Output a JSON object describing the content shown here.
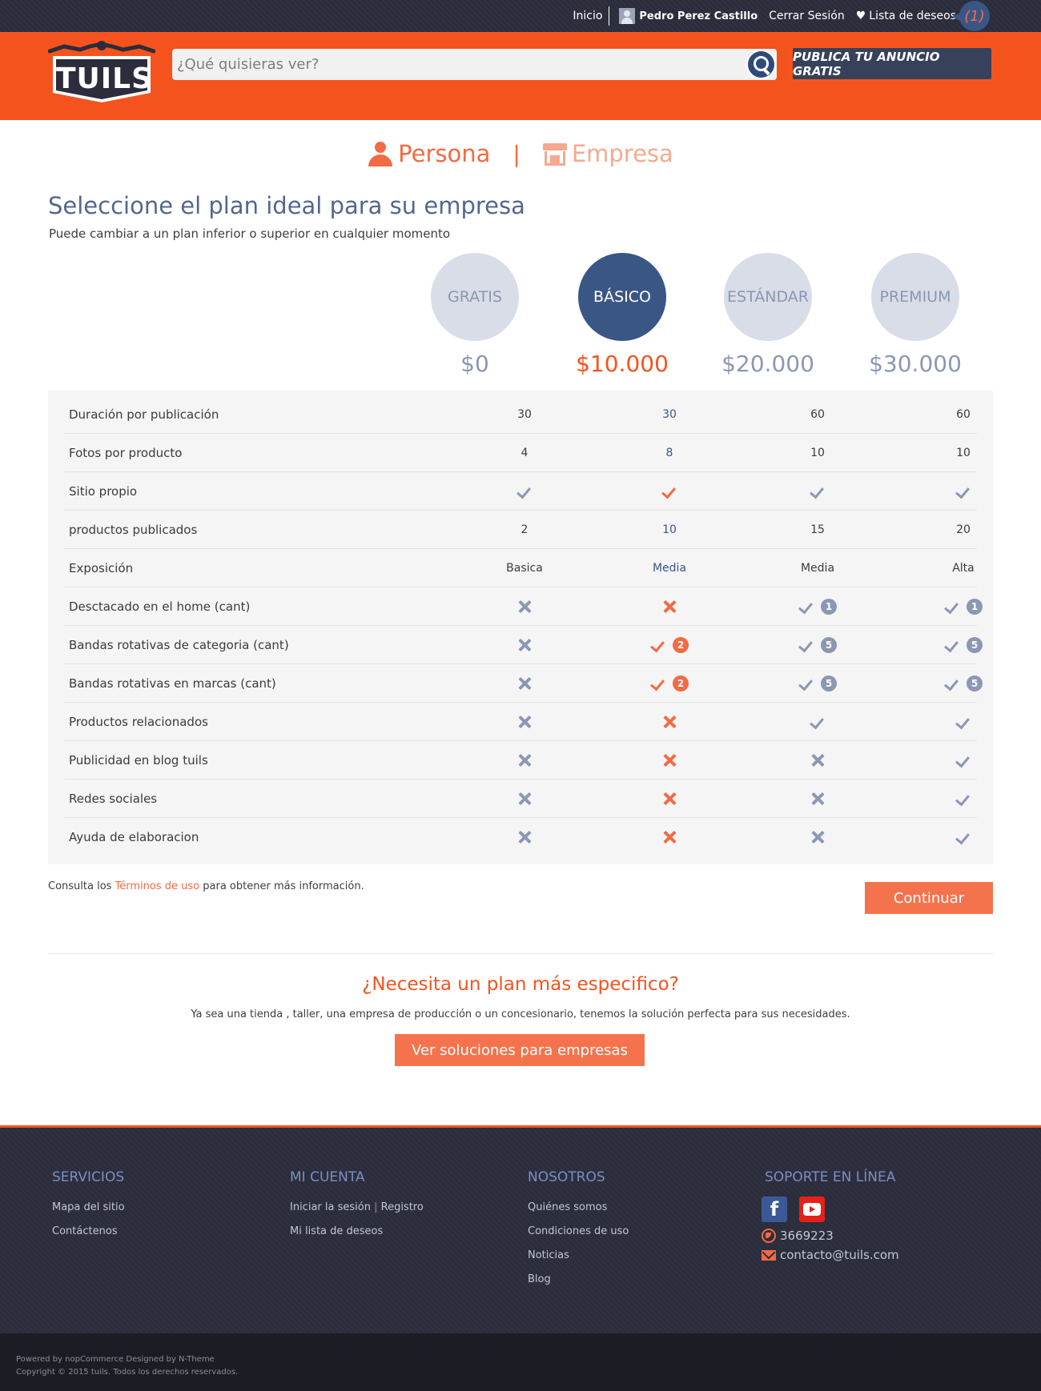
{
  "topbar": {
    "home": "Inicio",
    "user": "Pedro Perez Castillo",
    "logout": "Cerrar Sesión",
    "wishlist": "Lista de deseos",
    "wishlist_count": "(1)"
  },
  "header": {
    "logo_text": "TUILS",
    "search_placeholder": "¿Qué quisieras ver?",
    "publish_button": "PUBLICA TU ANUNCIO GRATIS"
  },
  "type_tabs": {
    "persona": "Persona",
    "separator": "|",
    "empresa": "Empresa"
  },
  "page": {
    "title": "Seleccione el plan ideal para su empresa",
    "subtitle": "Puede cambiar a un plan inferior o superior en cualquier momento"
  },
  "plans": [
    {
      "name": "GRATIS",
      "price": "$0",
      "active": false
    },
    {
      "name": "BÁSICO",
      "price": "$10.000",
      "active": true
    },
    {
      "name": "ESTÁNDAR",
      "price": "$20.000",
      "active": false
    },
    {
      "name": "PREMIUM",
      "price": "$30.000",
      "active": false
    }
  ],
  "features": [
    {
      "label": "Duración por publicación",
      "cells": [
        {
          "text": "30"
        },
        {
          "text": "30"
        },
        {
          "text": "60"
        },
        {
          "text": "60"
        }
      ]
    },
    {
      "label": "Fotos por producto",
      "cells": [
        {
          "text": "4"
        },
        {
          "text": "8"
        },
        {
          "text": "10"
        },
        {
          "text": "10"
        }
      ]
    },
    {
      "label": "Sitio propio",
      "cells": [
        {
          "icon": "check"
        },
        {
          "icon": "check"
        },
        {
          "icon": "check"
        },
        {
          "icon": "check"
        }
      ]
    },
    {
      "label": "productos publicados",
      "cells": [
        {
          "text": "2"
        },
        {
          "text": "10"
        },
        {
          "text": "15"
        },
        {
          "text": "20"
        }
      ]
    },
    {
      "label": "Exposición",
      "cells": [
        {
          "text": "Basica"
        },
        {
          "text": "Media"
        },
        {
          "text": "Media"
        },
        {
          "text": "Alta"
        }
      ]
    },
    {
      "label": "Desctacado en el home (cant)",
      "cells": [
        {
          "icon": "cross"
        },
        {
          "icon": "cross"
        },
        {
          "icon": "check",
          "badge": "1"
        },
        {
          "icon": "check",
          "badge": "1"
        }
      ]
    },
    {
      "label": "Bandas rotativas de categoria (cant)",
      "cells": [
        {
          "icon": "cross"
        },
        {
          "icon": "check",
          "badge": "2"
        },
        {
          "icon": "check",
          "badge": "5"
        },
        {
          "icon": "check",
          "badge": "5"
        }
      ]
    },
    {
      "label": "Bandas rotativas en marcas (cant)",
      "cells": [
        {
          "icon": "cross"
        },
        {
          "icon": "check",
          "badge": "2"
        },
        {
          "icon": "check",
          "badge": "5"
        },
        {
          "icon": "check",
          "badge": "5"
        }
      ]
    },
    {
      "label": "Productos relacionados",
      "cells": [
        {
          "icon": "cross"
        },
        {
          "icon": "cross"
        },
        {
          "icon": "check"
        },
        {
          "icon": "check"
        }
      ]
    },
    {
      "label": "Publicidad en blog tuils",
      "cells": [
        {
          "icon": "cross"
        },
        {
          "icon": "cross"
        },
        {
          "icon": "cross"
        },
        {
          "icon": "check"
        }
      ]
    },
    {
      "label": "Redes sociales",
      "cells": [
        {
          "icon": "cross"
        },
        {
          "icon": "cross"
        },
        {
          "icon": "cross"
        },
        {
          "icon": "check"
        }
      ]
    },
    {
      "label": "Ayuda de elaboracion",
      "cells": [
        {
          "icon": "cross"
        },
        {
          "icon": "cross"
        },
        {
          "icon": "cross"
        },
        {
          "icon": "check"
        }
      ]
    }
  ],
  "terms": {
    "before": "Consulta los ",
    "link": "Términos de uso",
    "after": " para obtener más información."
  },
  "continue_button": "Continuar",
  "cta": {
    "title": "¿Necesita un plan más especifico?",
    "text": "Ya sea una tienda , taller, una empresa de producción o un concesionario, tenemos la solución perfecta para sus necesidades.",
    "button": "Ver soluciones para empresas"
  },
  "footer": {
    "servicios": {
      "title": "SERVICIOS",
      "links": [
        "Mapa del sitio",
        "Contáctenos"
      ]
    },
    "mi_cuenta": {
      "title": "MI CUENTA",
      "login": "Iniciar la sesión",
      "pipe": "|",
      "register": "Registro",
      "wishlist": "Mi lista de deseos"
    },
    "nosotros": {
      "title": "NOSOTROS",
      "links": [
        "Quiénes somos",
        "Condiciones de uso",
        "Noticias",
        "Blog"
      ]
    },
    "soporte": {
      "title": "SOPORTE EN LÍNEA",
      "phone": "3669223",
      "email": "contacto@tuils.com"
    }
  },
  "bottom": {
    "powered": "Powered by nopCommerce Designed by N-Theme",
    "copyright": "Copyright © 2015 tuils. Todos los derechos reservados."
  },
  "colors": {
    "brand_orange": "#f5531e",
    "navy": "#3a5685",
    "dark_bg": "#2b2d3c"
  }
}
